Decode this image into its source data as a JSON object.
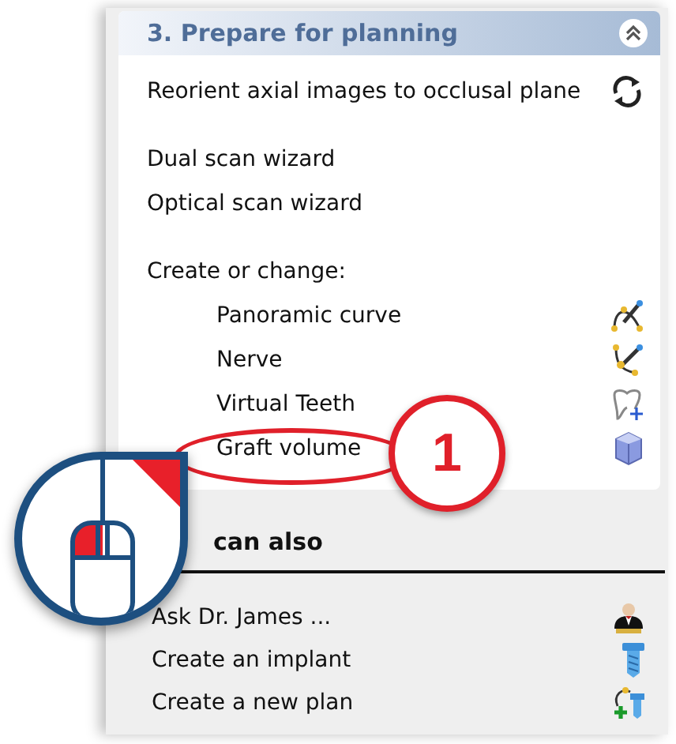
{
  "panel": {
    "title": "3. Prepare for planning",
    "groups": [
      [
        {
          "kind": "action",
          "label": "Reorient axial images to occlusal plane"
        }
      ],
      [
        {
          "kind": "action",
          "label": "Dual scan wizard"
        },
        {
          "kind": "action",
          "label": "Optical scan wizard"
        }
      ],
      [
        {
          "kind": "heading",
          "label": "Create or change:"
        },
        {
          "kind": "sub",
          "label": "Panoramic curve"
        },
        {
          "kind": "sub",
          "label": "Nerve"
        },
        {
          "kind": "sub",
          "label": "Virtual Teeth"
        },
        {
          "kind": "sub",
          "label": "Graft volume"
        }
      ]
    ]
  },
  "also": {
    "title": "can also",
    "items": [
      {
        "label": "Ask Dr. James ..."
      },
      {
        "label": "Create an implant"
      },
      {
        "label": "Create a new plan"
      }
    ]
  },
  "callout": {
    "number": "1"
  }
}
